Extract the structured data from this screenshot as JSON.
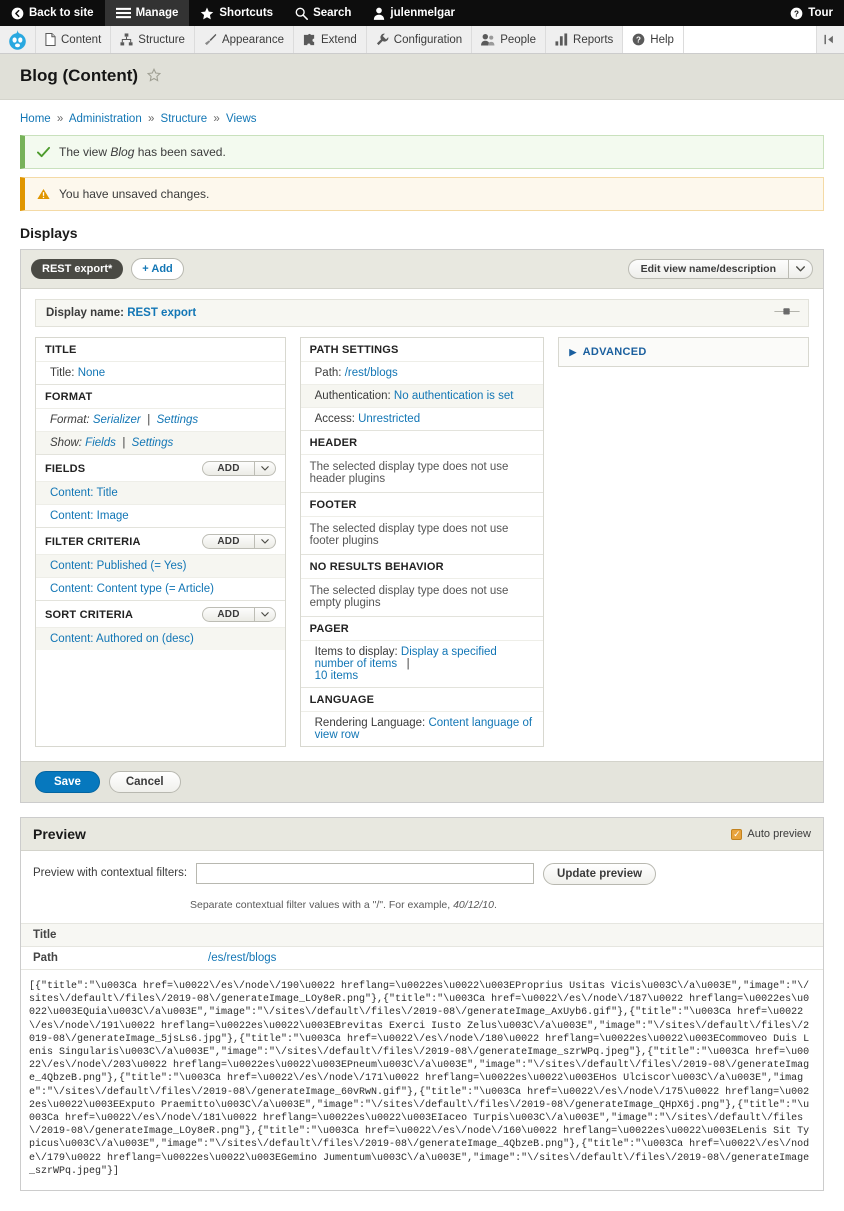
{
  "admin_toolbar": {
    "items": [
      {
        "label": "Back to site",
        "icon": "back-arrow-icon",
        "active": false
      },
      {
        "label": "Manage",
        "icon": "hamburger-icon",
        "active": true
      },
      {
        "label": "Shortcuts",
        "icon": "star-icon",
        "active": false
      },
      {
        "label": "Search",
        "icon": "search-icon",
        "active": false
      },
      {
        "label": "julenmelgar",
        "icon": "user-icon",
        "active": false
      }
    ],
    "right": {
      "label": "Tour",
      "icon": "help-circle-icon"
    }
  },
  "admin_tabs": {
    "logo": "drupal-logo-icon",
    "items": [
      {
        "label": "Content",
        "icon": "page-icon"
      },
      {
        "label": "Structure",
        "icon": "structure-icon"
      },
      {
        "label": "Appearance",
        "icon": "brush-icon"
      },
      {
        "label": "Extend",
        "icon": "puzzle-icon"
      },
      {
        "label": "Configuration",
        "icon": "wrench-icon"
      },
      {
        "label": "People",
        "icon": "people-icon"
      },
      {
        "label": "Reports",
        "icon": "bar-chart-icon"
      },
      {
        "label": "Help",
        "icon": "help-circle-icon"
      }
    ],
    "collapse_icon": "collapse-left-icon"
  },
  "page": {
    "title": "Blog (Content)",
    "star_icon": "star-outline-icon"
  },
  "breadcrumb": {
    "items": [
      "Home",
      "Administration",
      "Structure",
      "Views"
    ],
    "separator": "»"
  },
  "messages": [
    {
      "type": "status",
      "icon": "check-icon",
      "text_before": "The view ",
      "emphasis": "Blog",
      "text_after": " has been saved."
    },
    {
      "type": "warning",
      "icon": "warning-triangle-icon",
      "text_before": "You have unsaved changes.",
      "emphasis": "",
      "text_after": ""
    }
  ],
  "displays": {
    "heading": "Displays",
    "tabs": [
      {
        "label": "REST export*",
        "active": true
      }
    ],
    "add_label": "+ Add",
    "edit_view_button": "Edit view name/description",
    "edit_view_dropdown_icon": "chevron-down-icon",
    "display_name_label": "Display name:",
    "display_name_value": "REST export",
    "drag_handle_icon": "drag-handle-icon",
    "column_left": [
      {
        "bucket": "TITLE",
        "has_add": false,
        "rows": [
          {
            "label": "Title:",
            "value": "None",
            "alt": false,
            "italic": false
          }
        ]
      },
      {
        "bucket": "FORMAT",
        "has_add": false,
        "rows": [
          {
            "label": "Format:",
            "value": "Serializer",
            "value2": "Settings",
            "alt": false,
            "italic": true
          },
          {
            "label": "Show:",
            "value": "Fields",
            "value2": "Settings",
            "alt": true,
            "italic": true
          }
        ]
      },
      {
        "bucket": "FIELDS",
        "has_add": true,
        "add_label": "Add",
        "rows": [
          {
            "label": "",
            "value": "Content: Title",
            "alt": true,
            "italic": false
          },
          {
            "label": "",
            "value": "Content: Image",
            "alt": false,
            "italic": false
          }
        ]
      },
      {
        "bucket": "FILTER CRITERIA",
        "has_add": true,
        "add_label": "Add",
        "rows": [
          {
            "label": "",
            "value": "Content: Published (= Yes)",
            "alt": true,
            "italic": false
          },
          {
            "label": "",
            "value": "Content: Content type (= Article)",
            "alt": false,
            "italic": false
          }
        ]
      },
      {
        "bucket": "SORT CRITERIA",
        "has_add": true,
        "add_label": "Add",
        "rows": [
          {
            "label": "",
            "value": "Content: Authored on (desc)",
            "alt": true,
            "italic": false
          }
        ]
      }
    ],
    "column_middle": [
      {
        "bucket": "PATH SETTINGS",
        "rows": [
          {
            "label": "Path:",
            "value": "/rest/blogs",
            "alt": false
          },
          {
            "label": "Authentication:",
            "value": "No authentication is set",
            "alt": true
          },
          {
            "label": "Access:",
            "value": "Unrestricted",
            "alt": false
          }
        ]
      },
      {
        "bucket": "HEADER",
        "plain": "The selected display type does not use header plugins"
      },
      {
        "bucket": "FOOTER",
        "plain": "The selected display type does not use footer plugins"
      },
      {
        "bucket": "NO RESULTS BEHAVIOR",
        "plain": "The selected display type does not use empty plugins"
      },
      {
        "bucket": "PAGER",
        "rows": [
          {
            "label": "Items to display:",
            "value": "Display a specified number of items",
            "value2": "10 items",
            "alt": false
          }
        ]
      },
      {
        "bucket": "LANGUAGE",
        "rows": [
          {
            "label": "Rendering Language:",
            "value": "Content language of view row",
            "alt": false
          }
        ]
      }
    ],
    "advanced": {
      "label": "ADVANCED",
      "icon": "triangle-right-icon"
    },
    "save_label": "Save",
    "cancel_label": "Cancel"
  },
  "preview": {
    "heading": "Preview",
    "auto_preview_label": "Auto preview",
    "auto_preview_checked": true,
    "filter_label": "Preview with contextual filters:",
    "filter_value": "",
    "filter_placeholder": "",
    "update_button": "Update preview",
    "hint_before": "Separate contextual filter values with a \"/\". For example, ",
    "hint_emphasis": "40/12/10",
    "hint_after": ".",
    "rows": [
      {
        "label": "Title",
        "value": "",
        "is_link": false
      },
      {
        "label": "Path",
        "value": "/es/rest/blogs",
        "is_link": true
      }
    ],
    "json_output": "[{\"title\":\"\\u003Ca href=\\u0022\\/es\\/node\\/190\\u0022 hreflang=\\u0022es\\u0022\\u003EProprius Usitas Vicis\\u003C\\/a\\u003E\",\"image\":\"\\/sites\\/default\\/files\\/2019-08\\/generateImage_LOy8eR.png\"},{\"title\":\"\\u003Ca href=\\u0022\\/es\\/node\\/187\\u0022 hreflang=\\u0022es\\u0022\\u003EQuia\\u003C\\/a\\u003E\",\"image\":\"\\/sites\\/default\\/files\\/2019-08\\/generateImage_AxUyb6.gif\"},{\"title\":\"\\u003Ca href=\\u0022\\/es\\/node\\/191\\u0022 hreflang=\\u0022es\\u0022\\u003EBrevitas Exerci Iusto Zelus\\u003C\\/a\\u003E\",\"image\":\"\\/sites\\/default\\/files\\/2019-08\\/generateImage_5jsLs6.jpg\"},{\"title\":\"\\u003Ca href=\\u0022\\/es\\/node\\/180\\u0022 hreflang=\\u0022es\\u0022\\u003ECommoveo Duis Lenis Singularis\\u003C\\/a\\u003E\",\"image\":\"\\/sites\\/default\\/files\\/2019-08\\/generateImage_szrWPq.jpeg\"},{\"title\":\"\\u003Ca href=\\u0022\\/es\\/node\\/203\\u0022 hreflang=\\u0022es\\u0022\\u003EPneum\\u003C\\/a\\u003E\",\"image\":\"\\/sites\\/default\\/files\\/2019-08\\/generateImage_4QbzeB.png\"},{\"title\":\"\\u003Ca href=\\u0022\\/es\\/node\\/171\\u0022 hreflang=\\u0022es\\u0022\\u003EHos Ulciscor\\u003C\\/a\\u003E\",\"image\":\"\\/sites\\/default\\/files\\/2019-08\\/generateImage_60vRwN.gif\"},{\"title\":\"\\u003Ca href=\\u0022\\/es\\/node\\/175\\u0022 hreflang=\\u0022es\\u0022\\u003EExputo Praemitto\\u003C\\/a\\u003E\",\"image\":\"\\/sites\\/default\\/files\\/2019-08\\/generateImage_QHpX6j.png\"},{\"title\":\"\\u003Ca href=\\u0022\\/es\\/node\\/181\\u0022 hreflang=\\u0022es\\u0022\\u003EIaceo Turpis\\u003C\\/a\\u003E\",\"image\":\"\\/sites\\/default\\/files\\/2019-08\\/generateImage_LOy8eR.png\"},{\"title\":\"\\u003Ca href=\\u0022\\/es\\/node\\/160\\u0022 hreflang=\\u0022es\\u0022\\u003ELenis Sit Typicus\\u003C\\/a\\u003E\",\"image\":\"\\/sites\\/default\\/files\\/2019-08\\/generateImage_4QbzeB.png\"},{\"title\":\"\\u003Ca href=\\u0022\\/es\\/node\\/179\\u0022 hreflang=\\u0022es\\u0022\\u003EGemino Jumentum\\u003C\\/a\\u003E\",\"image\":\"\\/sites\\/default\\/files\\/2019-08\\/generateImage_szrWPq.jpeg\"}]"
  },
  "colors": {
    "link": "#1276b5",
    "primary_button": "#0678be",
    "toolbar_bg": "#0d0d0d",
    "status_green": "#77b259",
    "warning_orange": "#e09600",
    "page_head_bg": "#e0e0d8"
  }
}
